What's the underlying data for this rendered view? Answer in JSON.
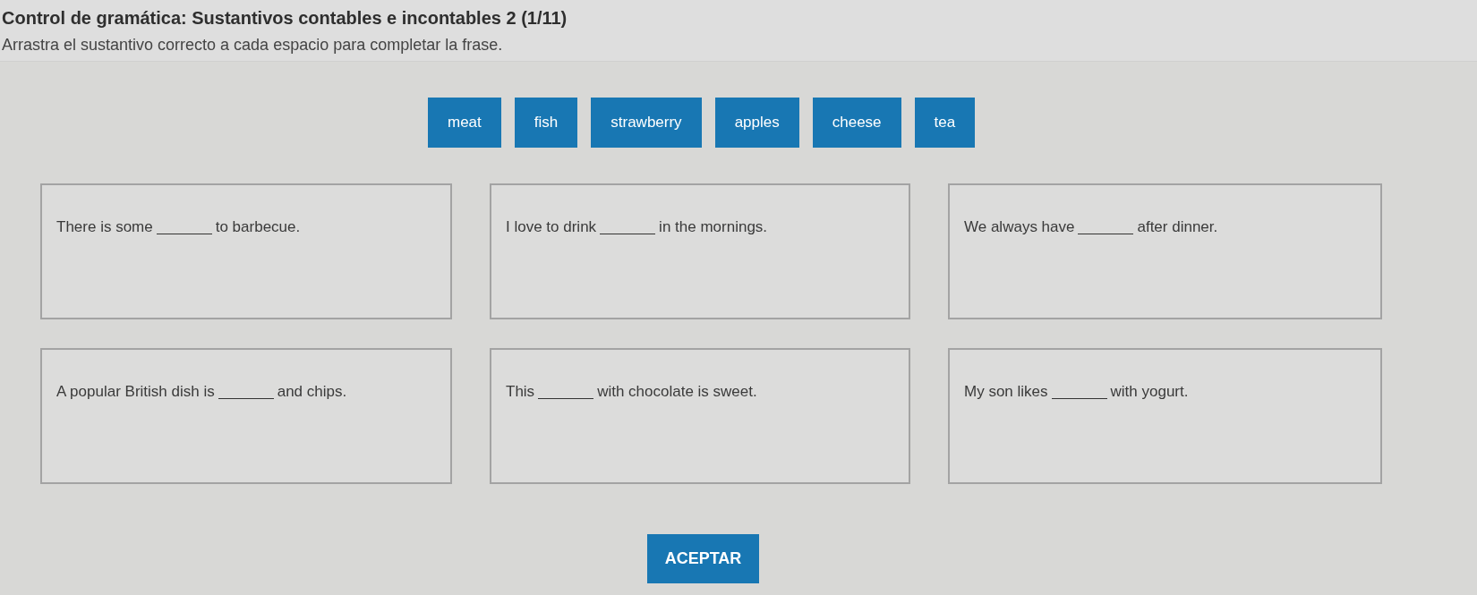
{
  "title": "Control de gramática: Sustantivos contables e incontables 2 (1/11)",
  "instruction": "Arrastra el sustantivo correcto a cada espacio para completar la frase.",
  "word_bank": [
    "meat",
    "fish",
    "strawberry",
    "apples",
    "cheese",
    "tea"
  ],
  "sentences": [
    {
      "before": "There is some",
      "after": "to barbecue."
    },
    {
      "before": "I love to drink",
      "after": "in the mornings."
    },
    {
      "before": "We always have",
      "after": "after dinner."
    },
    {
      "before": "A popular British dish is",
      "after": "and chips."
    },
    {
      "before": "This",
      "after": "with chocolate is sweet."
    },
    {
      "before": "My son likes",
      "after": "with yogurt."
    }
  ],
  "button": "ACEPTAR"
}
